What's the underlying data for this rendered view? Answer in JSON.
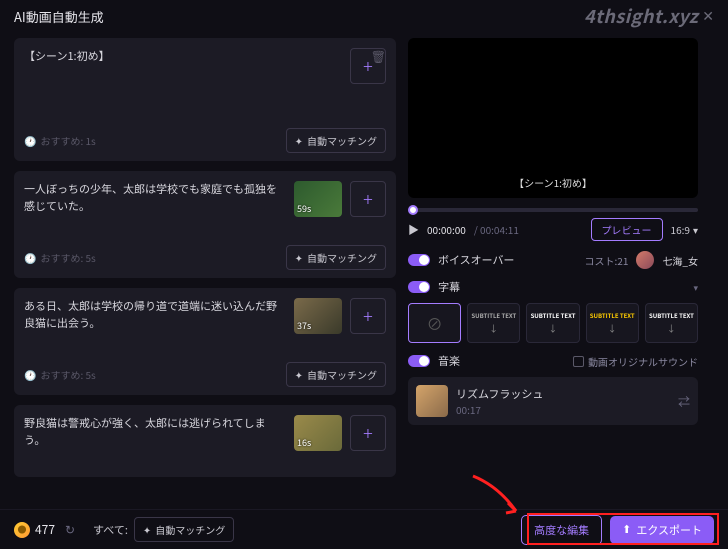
{
  "header": {
    "title": "AI動画自動生成",
    "watermark": "4thsight.xyz"
  },
  "scenes": [
    {
      "text": "【シーン1:初め】",
      "recommend": "おすすめ: 1s",
      "automatch": "自動マッチング",
      "thumb_dur": "",
      "has_thumb": false,
      "tall": true
    },
    {
      "text": "一人ぼっちの少年、太郎は学校でも家庭でも孤独を感じていた。",
      "recommend": "おすすめ: 5s",
      "automatch": "自動マッチング",
      "thumb_dur": "59s",
      "has_thumb": true,
      "thumb_class": "thumb-green"
    },
    {
      "text": "ある日、太郎は学校の帰り道で道端に迷い込んだ野良猫に出会う。",
      "recommend": "おすすめ: 5s",
      "automatch": "自動マッチング",
      "thumb_dur": "37s",
      "has_thumb": true,
      "thumb_class": "thumb-cat"
    },
    {
      "text": "野良猫は警戒心が強く、太郎には逃げられてしまう。",
      "recommend": "おすすめ: 5s",
      "automatch": "自動マッチング",
      "thumb_dur": "16s",
      "has_thumb": true,
      "thumb_class": "thumb-field"
    }
  ],
  "preview": {
    "scene_label": "【シーン1:初め】",
    "time_current": "00:00:00",
    "time_total": "00:04:11",
    "preview_btn": "プレビュー",
    "aspect": "16:9"
  },
  "settings": {
    "voiceover_label": "ボイスオーバー",
    "cost_label": "コスト:",
    "cost_value": "21",
    "voice_name": "七海_女",
    "subtitles_label": "字幕",
    "sub_opts": [
      "",
      "SUBTITLE TEXT",
      "SUBTITLE TEXT",
      "SUBTITLE TEXT",
      "SUBTITLE TEXT"
    ],
    "music_label": "音楽",
    "orig_sound": "動画オリジナルサウンド",
    "music_title": "リズムフラッシュ",
    "music_dur": "00:17"
  },
  "bottom": {
    "coins": "477",
    "all_label": "すべて:",
    "all_automatch": "自動マッチング",
    "advanced_btn": "高度な編集",
    "export_btn": "エクスポート"
  }
}
